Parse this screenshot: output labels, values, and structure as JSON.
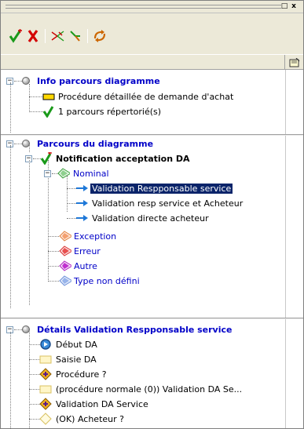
{
  "window": {
    "minimize_glyph": "□",
    "close_glyph": "x"
  },
  "toolbar": {
    "buttons": [
      {
        "name": "add-path-button",
        "icon": "green-checkmark-plus-icon"
      },
      {
        "name": "delete-button",
        "icon": "red-x-icon"
      },
      {
        "name": "expand-paths-button",
        "icon": "branching-paths-icon"
      },
      {
        "name": "link-paths-button",
        "icon": "path-link-icon"
      },
      {
        "name": "refresh-button",
        "icon": "cycle-arrows-icon"
      }
    ]
  },
  "columns": {
    "icon_header": "note-icon"
  },
  "tree": {
    "section1": {
      "title": "Info parcours diagramme",
      "items": [
        {
          "label": "Procédure détaillée de demande d'achat",
          "icon": "yellow-folder-icon"
        },
        {
          "label": "1 parcours répertorié(s)",
          "icon": "green-check-icon"
        }
      ]
    },
    "section2": {
      "title": "Parcours du diagramme",
      "root": {
        "label": "Notification acceptation DA",
        "icon": "green-check-icon"
      },
      "nominal": {
        "label": "Nominal",
        "icon": "green-diamond-icon"
      },
      "paths": [
        {
          "label": "Validation Respponsable service",
          "icon": "blue-arrow-icon",
          "selected": true
        },
        {
          "label": "Validation resp service et Acheteur",
          "icon": "blue-arrow-icon"
        },
        {
          "label": "Validation directe acheteur",
          "icon": "blue-arrow-icon"
        }
      ],
      "types": [
        {
          "label": "Exception",
          "icon": "orange-diamond-icon"
        },
        {
          "label": "Erreur",
          "icon": "red-diamond-icon"
        },
        {
          "label": "Autre",
          "icon": "purple-diamond-icon"
        },
        {
          "label": "Type non défini",
          "icon": "lightblue-diamond-icon"
        }
      ]
    },
    "section3": {
      "title": "Détails Validation Respponsable service",
      "items": [
        {
          "label": "Début DA",
          "icon": "start-circle-icon"
        },
        {
          "label": "Saisie DA",
          "icon": "task-box-icon"
        },
        {
          "label": "Procédure ?",
          "icon": "gateway-icon"
        },
        {
          "label": "(procédure normale (0)) Validation DA Se...",
          "icon": "task-box-icon"
        },
        {
          "label": "Validation DA Service",
          "icon": "gateway-icon"
        },
        {
          "label": "(OK) Acheteur ?",
          "icon": "decision-diamond-icon"
        }
      ]
    }
  },
  "colors": {
    "selection": "#0a246a",
    "section_title": "#0000c8",
    "chrome": "#ece9d8"
  }
}
